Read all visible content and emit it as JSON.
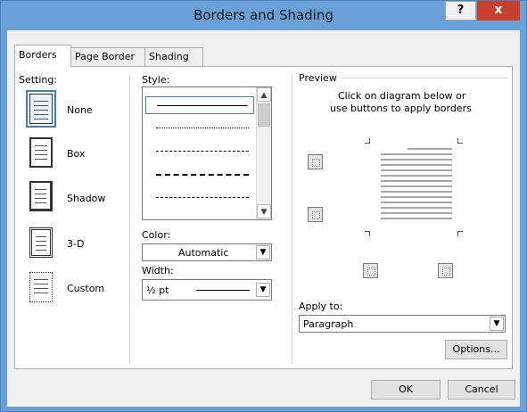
{
  "window": {
    "title": "Borders and Shading",
    "help_glyph": "?",
    "close_glyph": "x"
  },
  "tabs": [
    {
      "label": "Borders",
      "active": true
    },
    {
      "label": "Page Border"
    },
    {
      "label": "Shading"
    }
  ],
  "setting": {
    "label": "Setting:",
    "items": [
      {
        "label": "None"
      },
      {
        "label": "Box"
      },
      {
        "label": "Shadow"
      },
      {
        "label": "3-D"
      },
      {
        "label": "Custom"
      }
    ]
  },
  "style": {
    "label": "Style:",
    "items": [
      "solid",
      "dotted",
      "dashed-small",
      "dashed-large",
      "dash-dot"
    ]
  },
  "color": {
    "label": "Color:",
    "value": "Automatic"
  },
  "width": {
    "label": "Width:",
    "value": "½ pt"
  },
  "preview": {
    "label": "Preview",
    "instructions_line1": "Click on diagram below or",
    "instructions_line2": "use buttons to apply borders"
  },
  "apply_to": {
    "label": "Apply to:",
    "value": "Paragraph"
  },
  "buttons": {
    "options": "Options...",
    "ok": "OK",
    "cancel": "Cancel"
  },
  "colors": {
    "titlebar": "#6aa0d8",
    "close": "#c7402d",
    "selection": "#3c7fc4"
  }
}
